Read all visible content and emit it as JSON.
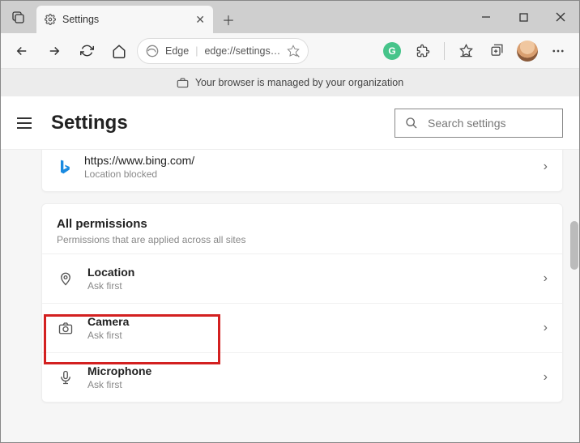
{
  "tab": {
    "title": "Settings"
  },
  "urlbar": {
    "edge": "Edge",
    "url": "edge://settings…"
  },
  "managed_msg": "Your browser is managed by your organization",
  "settings_title": "Settings",
  "search_placeholder": "Search settings",
  "recent": {
    "url": "https://www.bing.com/",
    "status": "Location blocked"
  },
  "section": {
    "title": "All permissions",
    "subtitle": "Permissions that are applied across all sites"
  },
  "permissions": [
    {
      "title": "Location",
      "sub": "Ask first"
    },
    {
      "title": "Camera",
      "sub": "Ask first"
    },
    {
      "title": "Microphone",
      "sub": "Ask first"
    }
  ]
}
